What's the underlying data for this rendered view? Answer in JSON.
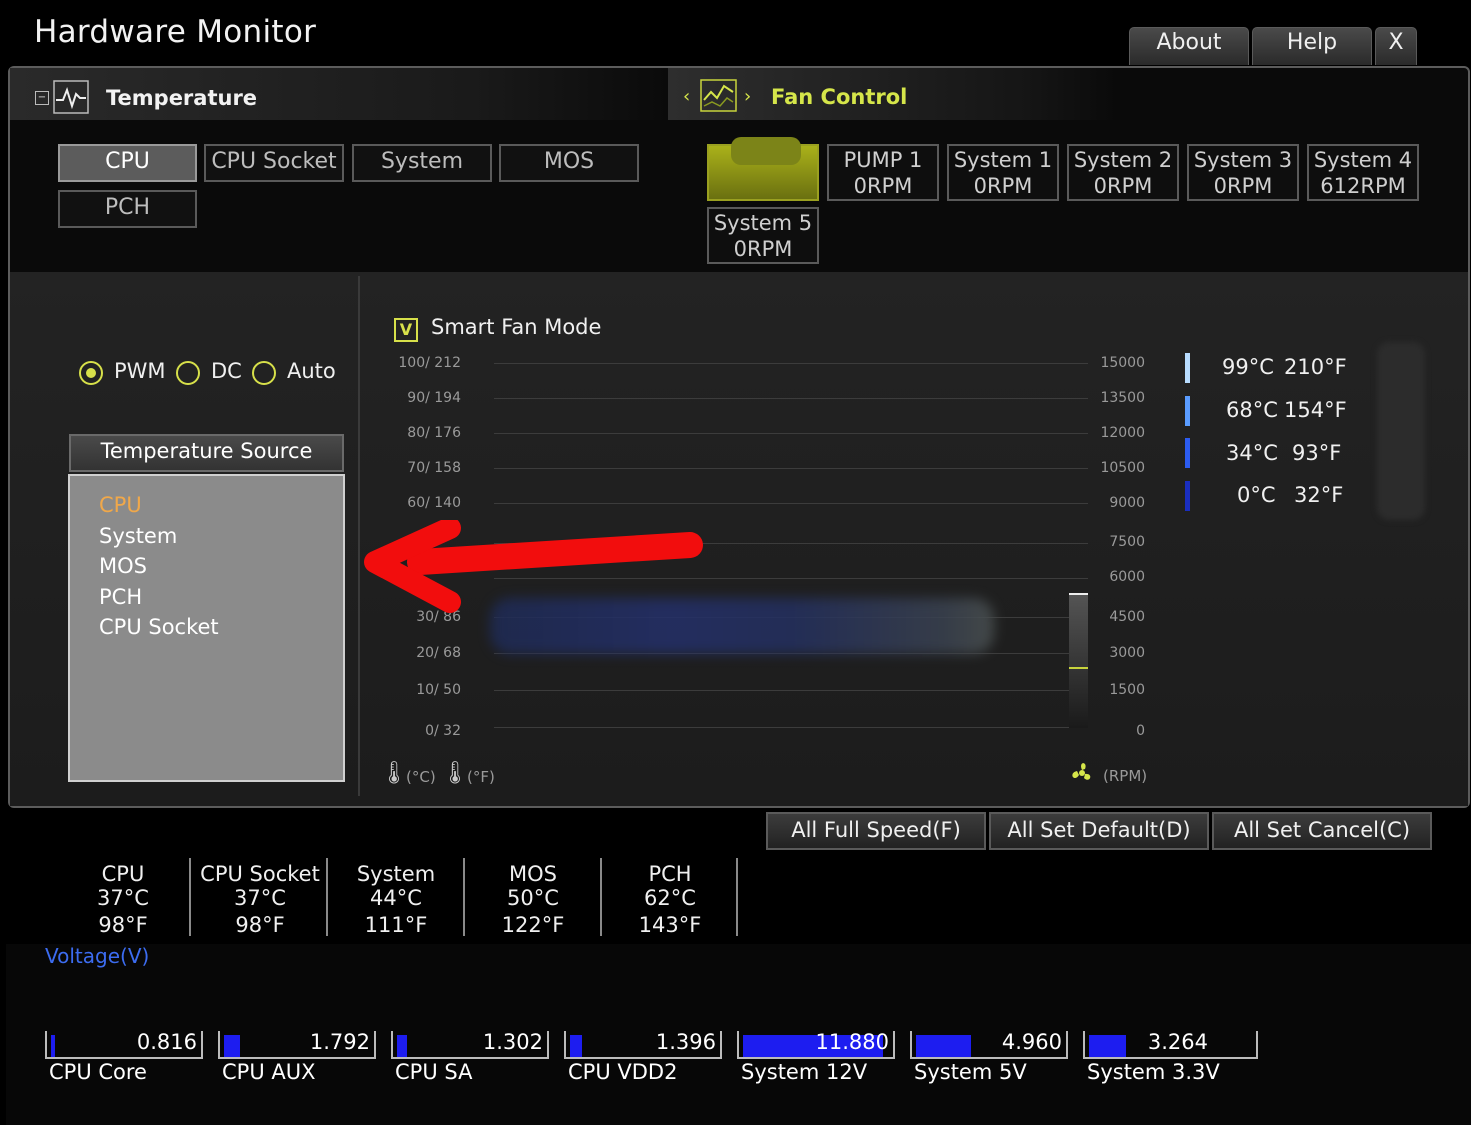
{
  "window": {
    "title": "Hardware Monitor",
    "buttons": {
      "about": "About",
      "help": "Help",
      "close": "X"
    }
  },
  "temperature": {
    "section_title": "Temperature",
    "tabs": [
      {
        "label": "CPU",
        "active": true
      },
      {
        "label": "CPU Socket"
      },
      {
        "label": "System"
      },
      {
        "label": "MOS"
      },
      {
        "label": "PCH"
      }
    ]
  },
  "fan_control": {
    "section_title": "Fan Control",
    "fans": [
      {
        "name": "",
        "rpm": "",
        "active": true
      },
      {
        "name": "PUMP 1",
        "rpm": "0RPM"
      },
      {
        "name": "System 1",
        "rpm": "0RPM"
      },
      {
        "name": "System 2",
        "rpm": "0RPM"
      },
      {
        "name": "System 3",
        "rpm": "0RPM"
      },
      {
        "name": "System 4",
        "rpm": "612RPM"
      },
      {
        "name": "System 5",
        "rpm": "0RPM"
      }
    ]
  },
  "mode": {
    "options": [
      "PWM",
      "DC",
      "Auto"
    ],
    "selected": "PWM"
  },
  "temperature_source": {
    "header": "Temperature Source",
    "items": [
      "CPU",
      "System",
      "MOS",
      "PCH",
      "CPU Socket"
    ],
    "selected": "CPU"
  },
  "smart_fan": {
    "label": "Smart Fan Mode",
    "checked": true,
    "checkbox_mark": "V"
  },
  "chart_data": {
    "type": "line",
    "y_left_ticks": [
      "100/ 212",
      "90/ 194",
      "80/ 176",
      "70/ 158",
      "60/ 140",
      "30/ 86",
      "20/ 68",
      "10/ 50",
      "0/ 32"
    ],
    "y_right_ticks": [
      "15000",
      "13500",
      "12000",
      "10500",
      "9000",
      "7500",
      "6000",
      "4500",
      "3000",
      "1500",
      "0"
    ],
    "x_unit_left": "(°C)",
    "x_unit_left2": "(°F)",
    "x_unit_right": "(RPM)"
  },
  "temp_legend": [
    {
      "c": "99°C",
      "f": "210°F",
      "color": "#b8dcff"
    },
    {
      "c": "68°C",
      "f": "154°F",
      "color": "#5a9cff"
    },
    {
      "c": "34°C",
      "f": "93°F",
      "color": "#2c5cf0"
    },
    {
      "c": "0°C",
      "f": "32°F",
      "color": "#1a2ec0"
    }
  ],
  "actions": {
    "full_speed": "All Full Speed(F)",
    "set_default": "All Set Default(D)",
    "set_cancel": "All Set Cancel(C)"
  },
  "sensors": [
    {
      "name": "CPU",
      "c": "37°C",
      "f": "98°F"
    },
    {
      "name": "CPU Socket",
      "c": "37°C",
      "f": "98°F"
    },
    {
      "name": "System",
      "c": "44°C",
      "f": "111°F"
    },
    {
      "name": "MOS",
      "c": "50°C",
      "f": "122°F"
    },
    {
      "name": "PCH",
      "c": "62°C",
      "f": "143°F"
    }
  ],
  "voltage": {
    "label": "Voltage(V)",
    "rails": [
      {
        "name": "CPU Core",
        "value": "0.816",
        "fill": 0.03
      },
      {
        "name": "CPU AUX",
        "value": "1.792",
        "fill": 0.11
      },
      {
        "name": "CPU SA",
        "value": "1.302",
        "fill": 0.07
      },
      {
        "name": "CPU VDD2",
        "value": "1.396",
        "fill": 0.08
      },
      {
        "name": "System 12V",
        "value": "11.880",
        "fill": 0.96
      },
      {
        "name": "System 5V",
        "value": "4.960",
        "fill": 0.38
      },
      {
        "name": "System 3.3V",
        "value": "3.264",
        "fill": 0.23
      }
    ]
  }
}
